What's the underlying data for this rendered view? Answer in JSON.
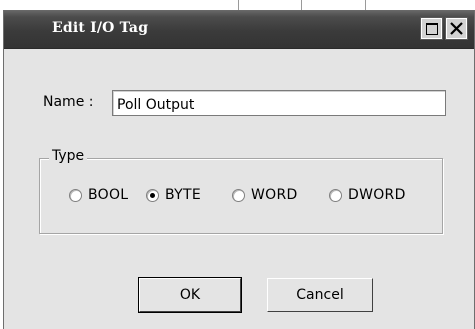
{
  "window": {
    "title": "Edit I/O Tag"
  },
  "titlebar_buttons": {
    "maximize_icon": "maximize-icon",
    "close_icon": "close-icon"
  },
  "form": {
    "name_label": "Name :",
    "name_value": "Poll Output"
  },
  "type_group": {
    "legend": "Type",
    "options": [
      {
        "label": "BOOL",
        "checked": false
      },
      {
        "label": "BYTE",
        "checked": true
      },
      {
        "label": "WORD",
        "checked": false
      },
      {
        "label": "DWORD",
        "checked": false
      }
    ]
  },
  "buttons": {
    "ok": "OK",
    "cancel": "Cancel"
  },
  "colors": {
    "titlebar": "#3b3b3b",
    "dialog_bg": "#e4e4e4",
    "title_text": "#ffffff"
  }
}
